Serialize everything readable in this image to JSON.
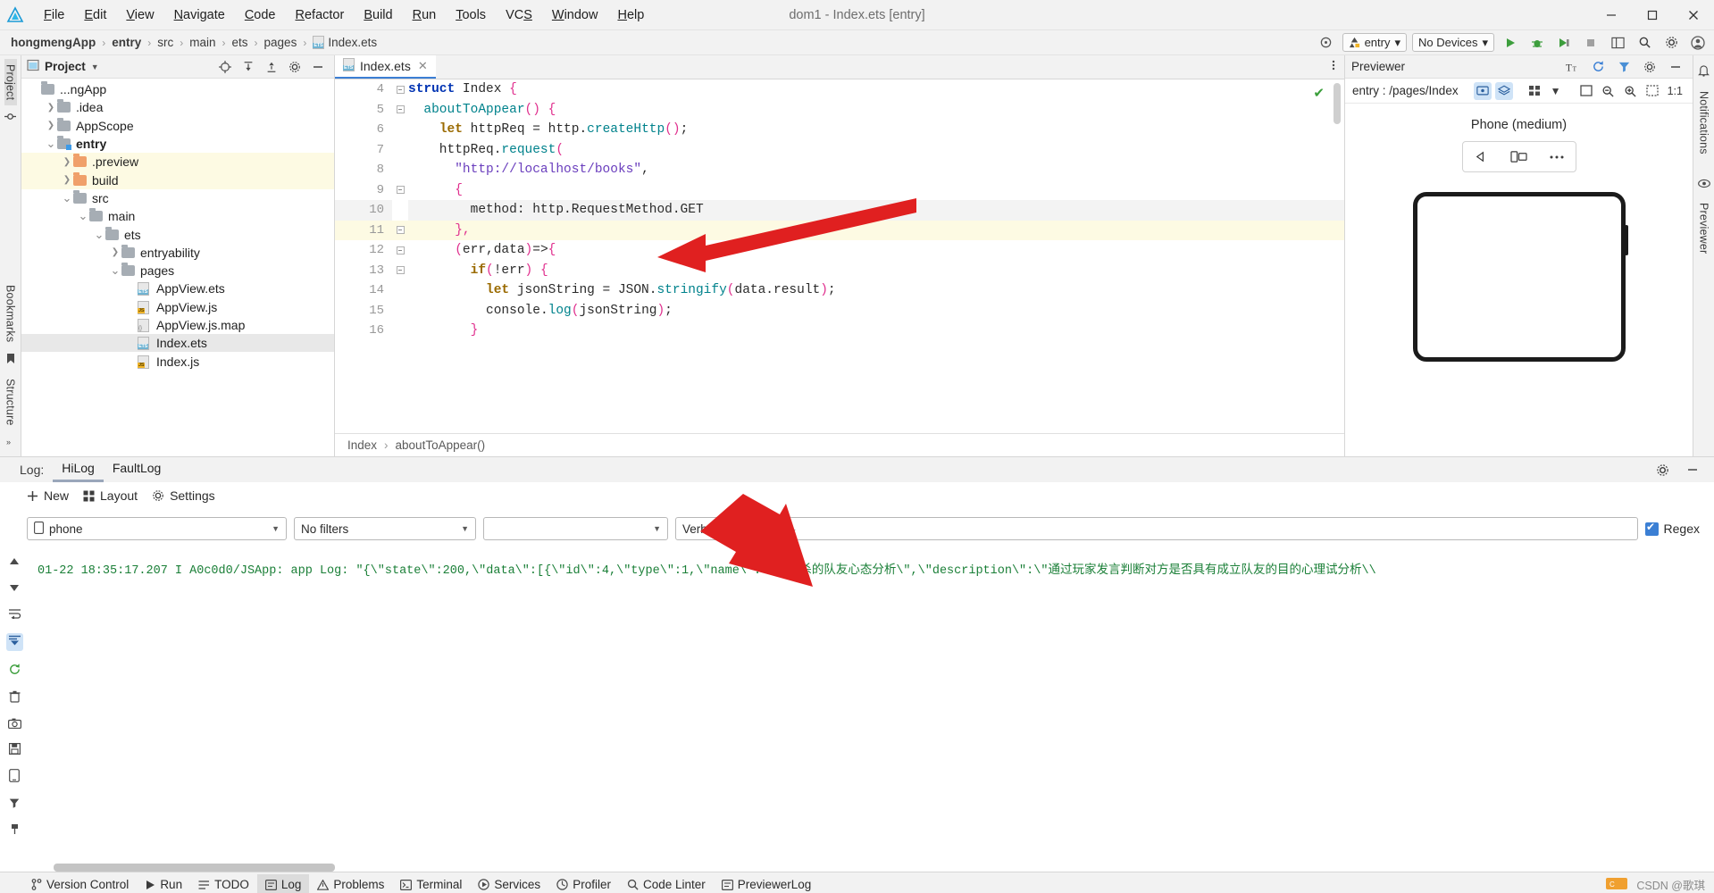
{
  "window": {
    "title": "dom1 - Index.ets [entry]",
    "logo_icon": "deveco-logo-icon",
    "minimize": "–",
    "maximize": "▢",
    "close": "✕"
  },
  "menubar": {
    "items": [
      {
        "label": "File",
        "mnemonic": "F"
      },
      {
        "label": "Edit",
        "mnemonic": "E"
      },
      {
        "label": "View",
        "mnemonic": "V"
      },
      {
        "label": "Navigate",
        "mnemonic": "N"
      },
      {
        "label": "Code",
        "mnemonic": "C"
      },
      {
        "label": "Refactor",
        "mnemonic": "R"
      },
      {
        "label": "Build",
        "mnemonic": "B"
      },
      {
        "label": "Run",
        "mnemonic": "R"
      },
      {
        "label": "Tools",
        "mnemonic": "T"
      },
      {
        "label": "VCS",
        "mnemonic": "S"
      },
      {
        "label": "Window",
        "mnemonic": "W"
      },
      {
        "label": "Help",
        "mnemonic": "H"
      }
    ]
  },
  "breadcrumbs": {
    "items": [
      "hongmengApp",
      "entry",
      "src",
      "main",
      "ets",
      "pages",
      "Index.ets"
    ],
    "separator": "›",
    "file_icon": "ets-file-icon"
  },
  "toolbar": {
    "target_icon": "target-icon",
    "module_selector": "entry",
    "device_selector": "No Devices",
    "run_icon": "run-icon",
    "debug_icon": "debug-icon",
    "profile_icon": "profile-icon",
    "stop_icon": "stop-icon",
    "layout_icon": "layout-icon",
    "search_icon": "search-icon",
    "settings_icon": "gear-icon",
    "account_icon": "account-icon",
    "chevron": "▾"
  },
  "left_rail": {
    "project_label": "Project",
    "bookmarks_label": "Bookmarks",
    "structure_label": "Structure",
    "icons": [
      "commit-icon",
      "bookmark-icon",
      "trash-icon",
      "build-icon",
      "device-icon",
      "phone-icon",
      "filter-icon",
      "more-icon"
    ]
  },
  "right_rail": {
    "notifications_label": "Notifications",
    "previewer_label": "Previewer"
  },
  "project_panel": {
    "title": "Project",
    "dropdown_icon": "chevron-down-icon",
    "locate_icon": "crosshair-icon",
    "expand_icon": "expand-all-icon",
    "collapse_icon": "collapse-all-icon",
    "settings_icon": "gear-icon",
    "hide_icon": "minimize-icon",
    "tree": [
      {
        "label": "...ngApp",
        "depth": 1,
        "arrow": "",
        "icon": "folder",
        "state": "clipped"
      },
      {
        "label": ".idea",
        "depth": 2,
        "arrow": "›",
        "icon": "folder"
      },
      {
        "label": "AppScope",
        "depth": 2,
        "arrow": "›",
        "icon": "folder"
      },
      {
        "label": "entry",
        "depth": 2,
        "arrow": "⌄",
        "icon": "folder-module",
        "bold": true
      },
      {
        "label": ".preview",
        "depth": 3,
        "arrow": "›",
        "icon": "folder-orange",
        "highlight": true
      },
      {
        "label": "build",
        "depth": 3,
        "arrow": "›",
        "icon": "folder-orange",
        "highlight": true
      },
      {
        "label": "src",
        "depth": 3,
        "arrow": "⌄",
        "icon": "folder"
      },
      {
        "label": "main",
        "depth": 4,
        "arrow": "⌄",
        "icon": "folder"
      },
      {
        "label": "ets",
        "depth": 5,
        "arrow": "⌄",
        "icon": "folder"
      },
      {
        "label": "entryability",
        "depth": 6,
        "arrow": "›",
        "icon": "folder"
      },
      {
        "label": "pages",
        "depth": 6,
        "arrow": "⌄",
        "icon": "folder"
      },
      {
        "label": "AppView.ets",
        "depth": 7,
        "arrow": "",
        "icon": "ets"
      },
      {
        "label": "AppView.js",
        "depth": 7,
        "arrow": "",
        "icon": "js"
      },
      {
        "label": "AppView.js.map",
        "depth": 7,
        "arrow": "",
        "icon": "map"
      },
      {
        "label": "Index.ets",
        "depth": 7,
        "arrow": "",
        "icon": "ets",
        "selected": true
      },
      {
        "label": "Index.js",
        "depth": 7,
        "arrow": "",
        "icon": "js"
      }
    ]
  },
  "editor": {
    "tab": {
      "label": "Index.ets",
      "icon": "ets-file-icon",
      "close": "✕"
    },
    "more_icon": "vertical-dots-icon",
    "inspection_ok_icon": "check-icon",
    "crumbs": [
      "Index",
      "aboutToAppear()"
    ],
    "crumb_sep": "›",
    "first_line_number": 4,
    "lines": [
      {
        "n": 4,
        "fold": true,
        "tokens": [
          {
            "t": "struct ",
            "c": "kw"
          },
          {
            "t": "Index ",
            "c": "id"
          },
          {
            "t": "{",
            "c": "br"
          }
        ]
      },
      {
        "n": 5,
        "fold": true,
        "tokens": [
          {
            "t": "  ",
            "c": "pl"
          },
          {
            "t": "aboutToAppear",
            "c": "fn"
          },
          {
            "t": "()",
            "c": "br"
          },
          {
            "t": " ",
            "c": "pl"
          },
          {
            "t": "{",
            "c": "br"
          }
        ]
      },
      {
        "n": 6,
        "fold": false,
        "tokens": [
          {
            "t": "    ",
            "c": "pl"
          },
          {
            "t": "let",
            "c": "kw2"
          },
          {
            "t": " httpReq ",
            "c": "id"
          },
          {
            "t": "=",
            "c": "pl"
          },
          {
            "t": " http.",
            "c": "id"
          },
          {
            "t": "createHttp",
            "c": "fn"
          },
          {
            "t": "()",
            "c": "br"
          },
          {
            "t": ";",
            "c": "pl"
          }
        ]
      },
      {
        "n": 7,
        "fold": false,
        "tokens": [
          {
            "t": "    httpReq",
            "c": "id"
          },
          {
            "t": ".",
            "c": "pl"
          },
          {
            "t": "request",
            "c": "fn"
          },
          {
            "t": "(",
            "c": "br"
          }
        ]
      },
      {
        "n": 8,
        "fold": false,
        "tokens": [
          {
            "t": "      ",
            "c": "pl"
          },
          {
            "t": "\"http://localhost/books\"",
            "c": "str"
          },
          {
            "t": ",",
            "c": "pl"
          }
        ]
      },
      {
        "n": 9,
        "fold": true,
        "tokens": [
          {
            "t": "      ",
            "c": "pl"
          },
          {
            "t": "{",
            "c": "br"
          }
        ]
      },
      {
        "n": 10,
        "fold": false,
        "shade": true,
        "tokens": [
          {
            "t": "        method",
            "c": "id"
          },
          {
            "t": ":",
            "c": "pl"
          },
          {
            "t": " http.RequestMethod.GET",
            "c": "id"
          }
        ]
      },
      {
        "n": 11,
        "fold": true,
        "hl": true,
        "tokens": [
          {
            "t": "      ",
            "c": "pl"
          },
          {
            "t": "}",
            "c": "br"
          },
          {
            "t": ",",
            "c": "br"
          }
        ]
      },
      {
        "n": 12,
        "fold": true,
        "tokens": [
          {
            "t": "      ",
            "c": "pl"
          },
          {
            "t": "(",
            "c": "br"
          },
          {
            "t": "err",
            "c": "id"
          },
          {
            "t": ",",
            "c": "pl"
          },
          {
            "t": "data",
            "c": "id"
          },
          {
            "t": ")",
            "c": "br"
          },
          {
            "t": "=>",
            "c": "pl"
          },
          {
            "t": "{",
            "c": "br"
          }
        ]
      },
      {
        "n": 13,
        "fold": true,
        "tokens": [
          {
            "t": "        ",
            "c": "pl"
          },
          {
            "t": "if",
            "c": "kw2"
          },
          {
            "t": "(",
            "c": "br"
          },
          {
            "t": "!err",
            "c": "id"
          },
          {
            "t": ")",
            "c": "br"
          },
          {
            "t": " ",
            "c": "pl"
          },
          {
            "t": "{",
            "c": "br"
          }
        ]
      },
      {
        "n": 14,
        "fold": false,
        "tokens": [
          {
            "t": "          ",
            "c": "pl"
          },
          {
            "t": "let",
            "c": "kw2"
          },
          {
            "t": " jsonString ",
            "c": "id"
          },
          {
            "t": "=",
            "c": "pl"
          },
          {
            "t": " JSON.",
            "c": "id"
          },
          {
            "t": "stringify",
            "c": "fn"
          },
          {
            "t": "(",
            "c": "br"
          },
          {
            "t": "data.result",
            "c": "id"
          },
          {
            "t": ")",
            "c": "br"
          },
          {
            "t": ";",
            "c": "pl"
          }
        ]
      },
      {
        "n": 15,
        "fold": false,
        "tokens": [
          {
            "t": "          console",
            "c": "id"
          },
          {
            "t": ".",
            "c": "pl"
          },
          {
            "t": "log",
            "c": "fn"
          },
          {
            "t": "(",
            "c": "br"
          },
          {
            "t": "jsonString",
            "c": "id"
          },
          {
            "t": ")",
            "c": "br"
          },
          {
            "t": ";",
            "c": "pl"
          }
        ]
      },
      {
        "n": 16,
        "fold": false,
        "tokens": [
          {
            "t": "        ",
            "c": "pl"
          },
          {
            "t": "}",
            "c": "br"
          }
        ]
      }
    ]
  },
  "previewer": {
    "title": "Previewer",
    "path": "entry : /pages/Index",
    "device_name": "Phone (medium)",
    "header_icons": [
      "font-size-icon",
      "refresh-icon",
      "filter-icon",
      "gear-icon",
      "minimize-icon"
    ],
    "toolbar_icons": [
      "inspector-icon",
      "layers-icon",
      "grid-icon",
      "chevron-down-icon",
      "frame-icon",
      "zoom-out-icon",
      "zoom-in-icon",
      "fit-icon"
    ],
    "zoom_level": "1:1",
    "device_buttons": [
      "rotate-icon",
      "multi-device-icon",
      "more-icon"
    ]
  },
  "log": {
    "panel_label": "Log:",
    "tabs": [
      {
        "label": "HiLog",
        "selected": true
      },
      {
        "label": "FaultLog",
        "selected": false
      }
    ],
    "settings_icon": "gear-icon",
    "hide_icon": "minimize-icon",
    "actions": [
      {
        "label": "New",
        "icon": "plus-icon"
      },
      {
        "label": "Layout",
        "icon": "layout-icon"
      },
      {
        "label": "Settings",
        "icon": "gear-icon"
      }
    ],
    "filters": {
      "device": "phone",
      "device_icon": "phone-icon",
      "process": "No filters",
      "package": "",
      "level": "Verbose",
      "search_placeholder": "Q-",
      "search_icon": "search-icon",
      "regex_label": "Regex",
      "regex_checked": true
    },
    "rail_icons": [
      "scroll-up-icon",
      "scroll-down-icon",
      "soft-wrap-icon",
      "scroll-to-end-icon",
      "restart-icon",
      "trash-icon",
      "camera-icon",
      "save-icon",
      "phone-icon",
      "filter-icon",
      "pin-icon"
    ],
    "entries": [
      {
        "timestamp": "01-22 18:35:17.207",
        "level": "I",
        "tag": "A0c0d0/JSApp:",
        "source": "app Log:",
        "message": "\"{\\\"state\\\":200,\\\"data\\\":[{\\\"id\\\":4,\\\"type\\\":1,\\\"name\\\":\\\"狼人杀的队友心态分析\\\",\\\"description\\\":\\\"通过玩家发言判断对方是否具有成立队友的目的心理试分析\\\\",
        "color": "#1a7f37"
      }
    ]
  },
  "status_bar": {
    "items": [
      {
        "label": "Version Control",
        "icon": "branch-icon"
      },
      {
        "label": "Run",
        "icon": "run-icon"
      },
      {
        "label": "TODO",
        "icon": "todo-icon"
      },
      {
        "label": "Log",
        "icon": "log-icon",
        "selected": true
      },
      {
        "label": "Problems",
        "icon": "warning-icon"
      },
      {
        "label": "Terminal",
        "icon": "terminal-icon"
      },
      {
        "label": "Services",
        "icon": "services-icon"
      },
      {
        "label": "Profiler",
        "icon": "profiler-icon"
      },
      {
        "label": "Code Linter",
        "icon": "linter-icon"
      },
      {
        "label": "PreviewerLog",
        "icon": "previewlog-icon"
      }
    ],
    "watermark": "CSDN @歌琪"
  },
  "annotations": {
    "arrow_color": "#e02020",
    "arrows": [
      "arrow-pointing-to-code-line-11",
      "arrow-pointing-to-log-output"
    ]
  },
  "colors": {
    "accent": "#3b7fd4",
    "log_green": "#1a7f37",
    "highlight_yellow": "#fdfae3",
    "folder_orange": "#f0a06a",
    "chrome": "#f2f2f2"
  }
}
